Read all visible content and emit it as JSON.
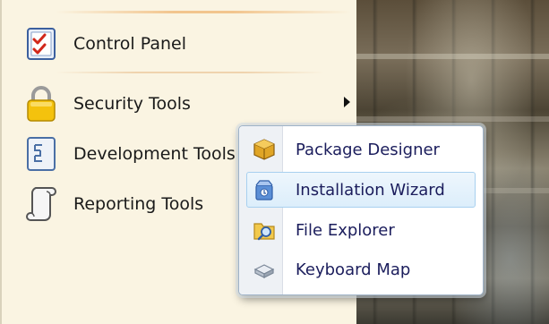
{
  "menu": {
    "items": [
      {
        "label": "Control Panel",
        "icon": "checklist-icon"
      },
      {
        "label": "Security Tools",
        "icon": "padlock-icon",
        "has_submenu": true
      },
      {
        "label": "Development Tools",
        "icon": "code-document-icon"
      },
      {
        "label": "Reporting Tools",
        "icon": "scroll-icon"
      }
    ]
  },
  "submenu": {
    "items": [
      {
        "label": "Package Designer",
        "icon": "package-icon"
      },
      {
        "label": "Installation Wizard",
        "icon": "install-box-icon",
        "highlighted": true
      },
      {
        "label": "File Explorer",
        "icon": "folder-magnifier-icon"
      },
      {
        "label": "Keyboard Map",
        "icon": "keyboard-key-icon"
      }
    ]
  },
  "colors": {
    "menu_background": "#faf4e2",
    "submenu_background": "#ffffff",
    "submenu_text": "#1b1d5c",
    "highlight_background": "#dceefb",
    "highlight_border": "#a8d0ef"
  }
}
